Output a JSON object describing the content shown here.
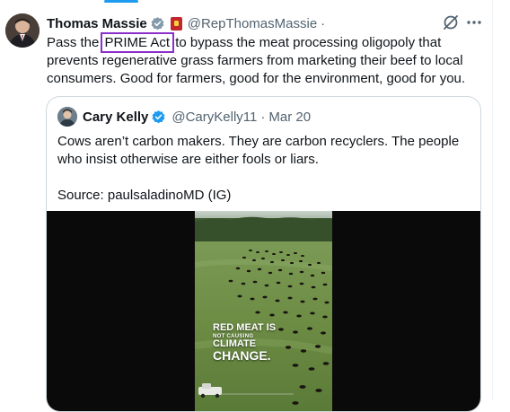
{
  "tweet": {
    "author_name": "Thomas Massie",
    "handle": "@RepThomasMassie",
    "separator": "·",
    "text_before": "Pass the ",
    "highlighted_phrase": "PRIME Act",
    "text_after": " to bypass the meat processing oligopoly that prevents regenerative grass farmers from marketing their beef to local consumers. Good for farmers, good for the environment, good for you.",
    "icons": [
      "avatar",
      "verified-badge-icon",
      "flag-icon",
      "grok-icon",
      "more-icon"
    ]
  },
  "quote": {
    "author_name": "Cary Kelly",
    "handle": "@CaryKelly11",
    "separator": "·",
    "date": "Mar 20",
    "text": "Cows aren’t carbon makers. They are carbon recyclers. The people who insist otherwise are either fools or liars.",
    "source": "Source: paulsaladinoMD (IG)",
    "video_overlay": {
      "line1": "RED MEAT IS",
      "line2": "NOT CAUSING",
      "line3": "CLIMATE",
      "line4": "CHANGE."
    }
  },
  "colors": {
    "verified": "#1d9bf0",
    "highlight_box": "#8b2fc9",
    "secondary_text": "#536471",
    "border": "#cfd9de"
  }
}
